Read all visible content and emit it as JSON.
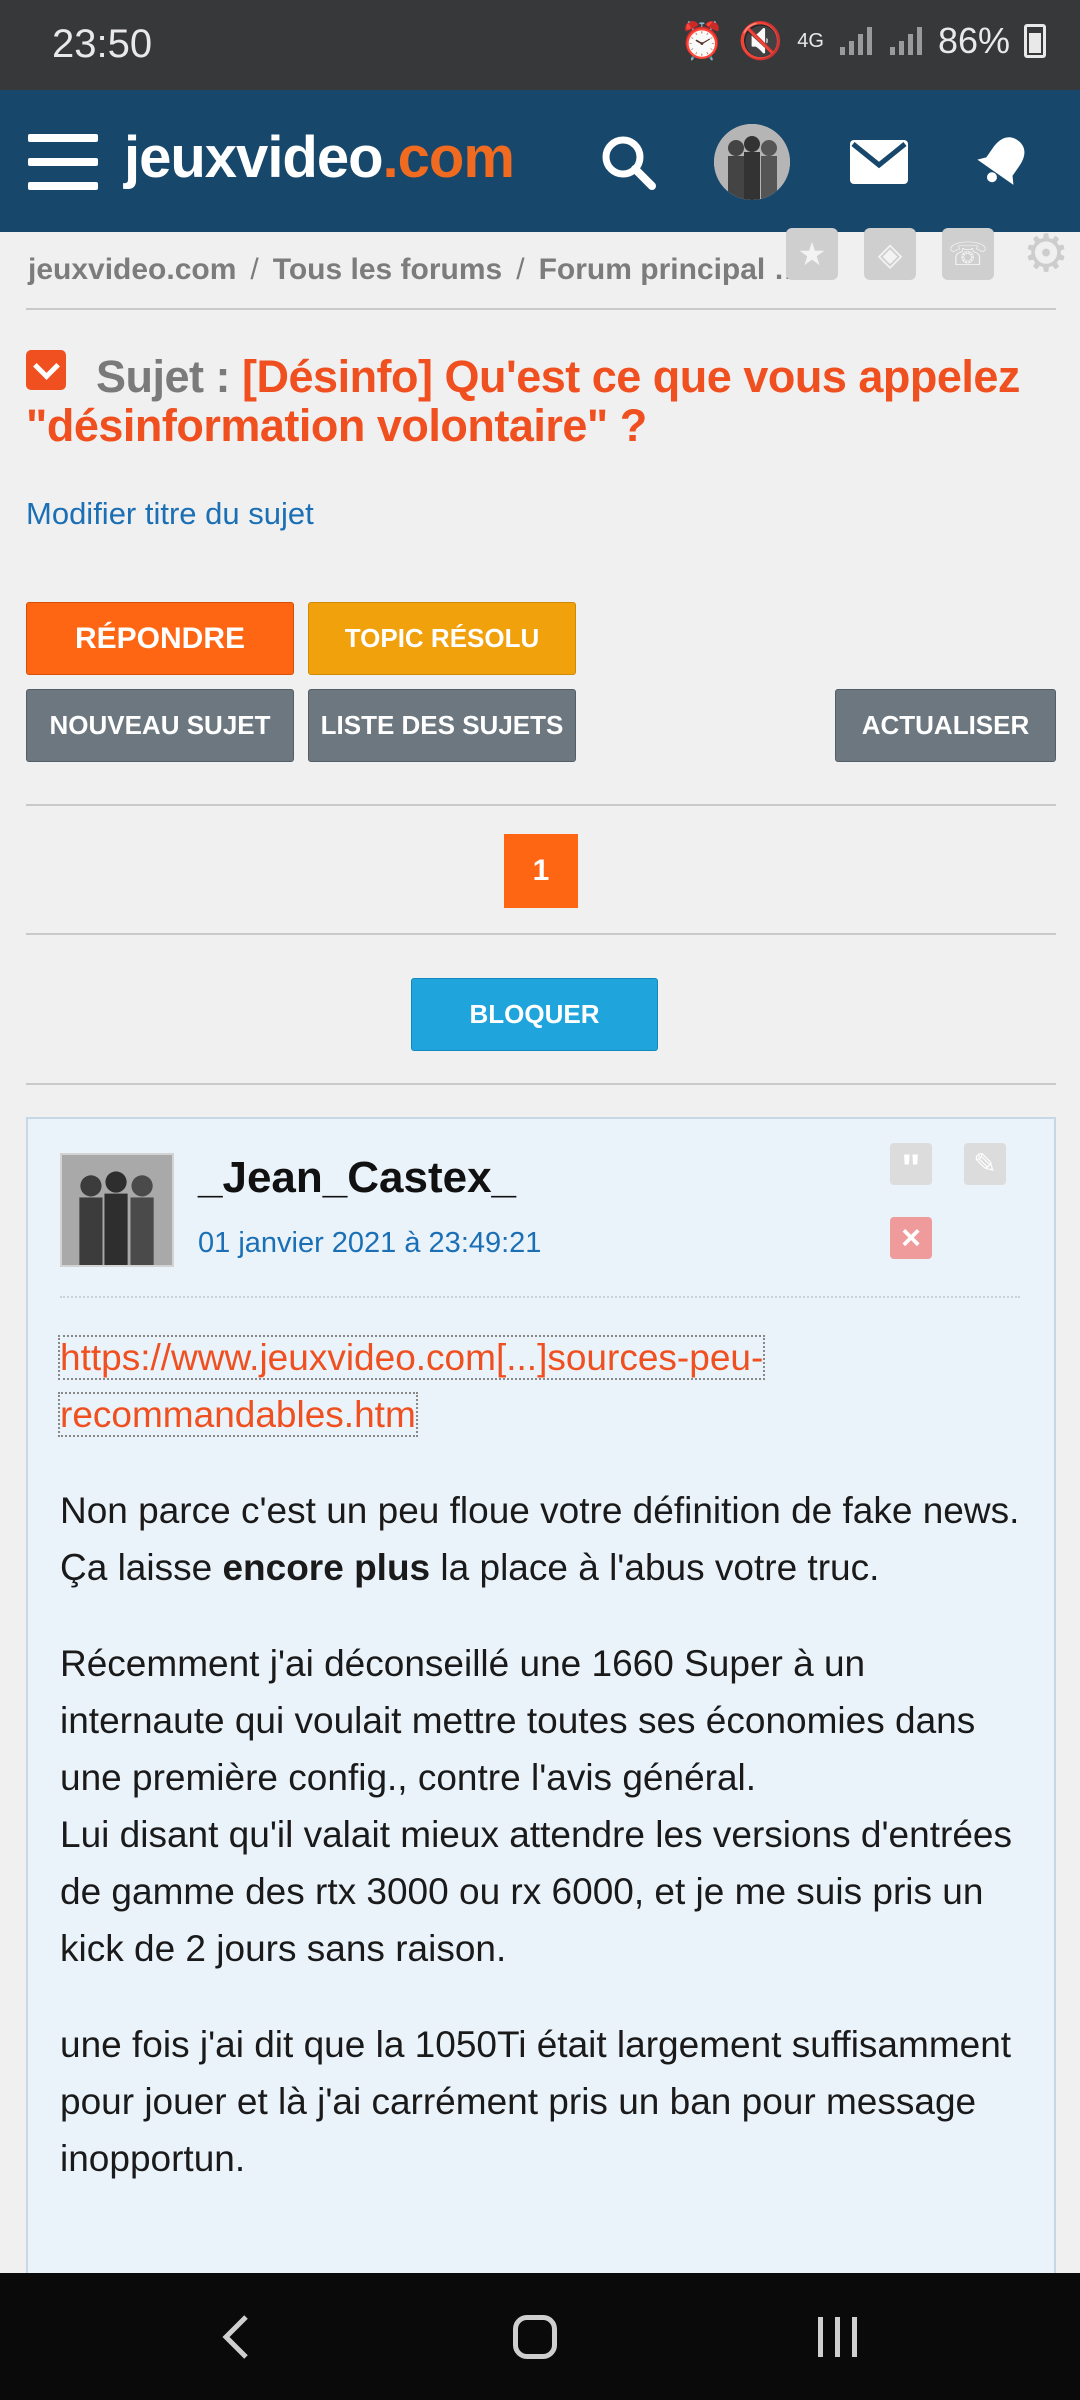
{
  "status_bar": {
    "time": "23:50",
    "network": "4G",
    "battery": "86%"
  },
  "app_bar": {
    "logo_main": "jeuxvideo",
    "logo_suffix": ".com"
  },
  "breadcrumb": {
    "items": [
      "jeuxvideo.com",
      "Tous les forums",
      "Forum principal Informatique"
    ],
    "separator": "/"
  },
  "topic": {
    "label": "Sujet :",
    "title": "[Désinfo] Qu'est ce que vous appelez \"désinformation volontaire\" ?",
    "modify_link": "Modifier titre du sujet"
  },
  "buttons": {
    "reply": "RÉPONDRE",
    "solved": "TOPIC RÉSOLU",
    "new_topic": "NOUVEAU SUJET",
    "topic_list": "LISTE DES SUJETS",
    "refresh": "ACTUALISER",
    "block": "BLOQUER"
  },
  "pagination": {
    "current": "1"
  },
  "post": {
    "author": "_Jean_Castex_",
    "date": "01 janvier 2021 à 23:49:21",
    "quote_icon": "quote-icon",
    "link": "https://www.jeuxvideo.com[...]sources-peu-recommandables.htm",
    "p1_line1": "Non parce c'est un peu floue votre définition de fake news.",
    "p1_line2_before": "Ça laisse ",
    "p1_line2_bold": "encore plus",
    "p1_line2_after": " la place à l'abus votre truc.",
    "p2_line1": "Récemment j'ai déconseillé une 1660 Super à un internaute qui voulait mettre toutes ses économies dans une première config., contre l'avis général.",
    "p2_line2": "Lui disant qu'il valait mieux attendre les versions d'entrées de gamme des rtx 3000 ou rx 6000, et je me suis pris un kick de 2 jours sans raison.",
    "p3": "une fois j'ai dit que la 1050Ti était largement suffisamment pour jouer et là j'ai carrément pris un ban pour message inopportun."
  },
  "colors": {
    "brand_blue": "#17486b",
    "accent_orange": "#ff6613",
    "link_blue": "#1b6fb5"
  }
}
